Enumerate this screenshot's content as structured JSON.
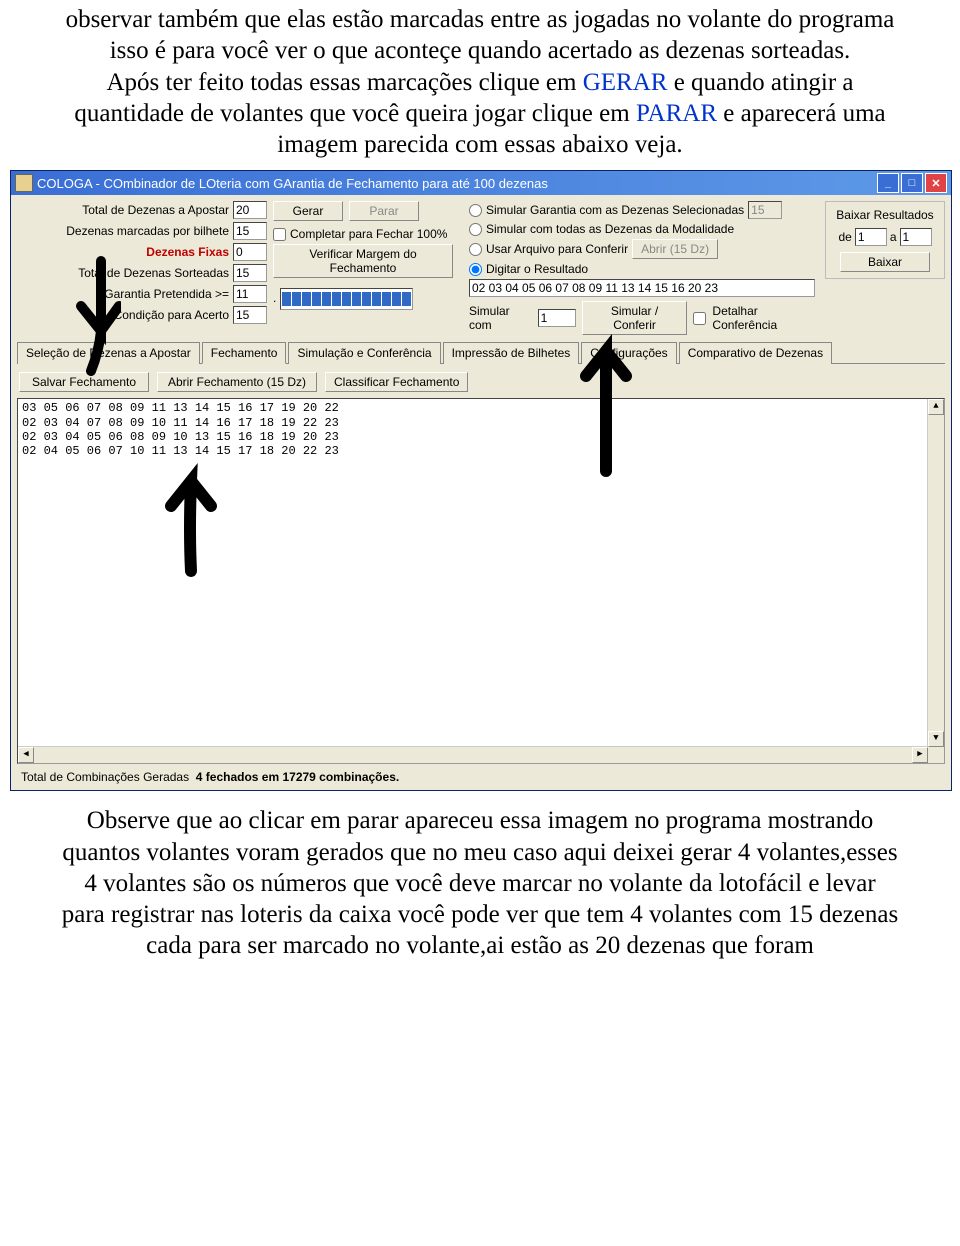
{
  "intro": {
    "p1": "observar também que elas estão marcadas entre as jogadas no volante do programa isso é para você ver o que aconteçe quando acertado as dezenas sorteadas.",
    "p2a": "Após ter feito todas essas marcações clique em ",
    "p2b": " e quando atingir a quantidade de volantes que você queira jogar clique em ",
    "p2c": " e aparecerá uma imagem parecida com essas abaixo veja.",
    "gerar": "GERAR",
    "parar": "PARAR"
  },
  "window": {
    "title": "COLOGA - COmbinador de LOteria com GArantia de Fechamento para até 100 dezenas"
  },
  "left": {
    "total_dezenas_label": "Total de Dezenas a Apostar",
    "total_dezenas": "20",
    "marcadas_label": "Dezenas marcadas por bilhete",
    "marcadas": "15",
    "fixas_label": "Dezenas Fixas",
    "fixas": "0",
    "sorteadas_label": "Total de Dezenas Sorteadas",
    "sorteadas": "15",
    "garantia_label": "Garantia Pretendida >=",
    "garantia": "11",
    "condicao_label": "Condição para Acerto",
    "condicao": "15"
  },
  "mid": {
    "gerar": "Gerar",
    "parar": "Parar",
    "completar": "Completar para Fechar 100%",
    "verificar": "Verificar Margem do Fechamento"
  },
  "right": {
    "sim_garantia": "Simular Garantia com as Dezenas Selecionadas",
    "sim_garantia_val": "15",
    "sim_todas": "Simular com todas as Dezenas da Modalidade",
    "usar_arquivo": "Usar Arquivo para Conferir",
    "abrir_btn": "Abrir (15 Dz)",
    "digitar": "Digitar o Resultado",
    "resultado": "02 03 04 05 06 07 08 09 11 13 14 15 16 20 23",
    "simular_com": "Simular com",
    "simular_com_val": "1",
    "simular_conferir": "Simular / Conferir",
    "detalhar": "Detalhar Conferência"
  },
  "far": {
    "baixar_res": "Baixar Resultados",
    "de": "de",
    "de_val": "1",
    "a": "a",
    "a_val": "1",
    "baixar": "Baixar"
  },
  "tabs": [
    "Seleção de Dezenas a Apostar",
    "Fechamento",
    "Simulação e Conferência",
    "Impressão de Bilhetes",
    "Configurações",
    "Comparativo de Dezenas"
  ],
  "actions": {
    "salvar": "Salvar Fechamento",
    "abrir": "Abrir Fechamento (15 Dz)",
    "classificar": "Classificar Fechamento"
  },
  "results": [
    "03 05 06 07 08 09 11 13 14 15 16 17 19 20 22",
    "02 03 04 07 08 09 10 11 14 16 17 18 19 22 23",
    "02 03 04 05 06 08 09 10 13 15 16 18 19 20 23",
    "02 04 05 06 07 10 11 13 14 15 17 18 20 22 23"
  ],
  "status": {
    "label": "Total de Combinações Geradas",
    "value": "4 fechados em 17279 combinações."
  },
  "outro": {
    "p1": "Observe que ao clicar em parar apareceu essa imagem no programa mostrando quantos volantes voram gerados que no meu caso aqui deixei gerar 4 volantes,esses 4 volantes são os números que você deve marcar no volante da lotofácil e levar para registrar nas loteris da caixa você pode ver que tem 4 volantes com 15 dezenas cada para ser marcado no volante,ai estão as 20 dezenas que foram"
  }
}
